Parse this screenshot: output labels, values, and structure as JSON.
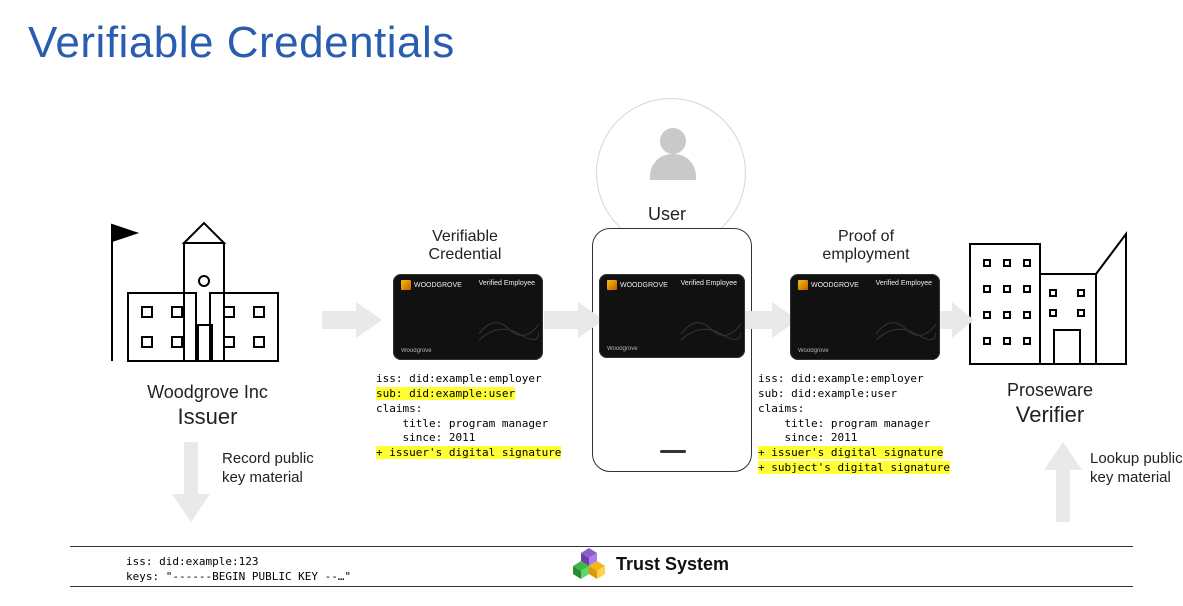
{
  "title": "Verifiable Credentials",
  "issuer": {
    "name": "Woodgrove Inc",
    "role": "Issuer"
  },
  "user": {
    "label": "User"
  },
  "verifier": {
    "name": "Proseware",
    "role": "Verifier"
  },
  "flows": {
    "vc_label": "Verifiable\nCredential",
    "proof_label": "Proof of\nemployment",
    "record_label": "Record public\nkey material",
    "lookup_label": "Lookup public\nkey material"
  },
  "card": {
    "brand": "WOODGROVE",
    "tag": "Verified Employee",
    "issuer_name": "Woodgrove"
  },
  "vc_claims": {
    "iss": "iss: did:example:employer",
    "sub": "sub: did:example:user",
    "claims_h": "claims:",
    "title": "    title: program manager",
    "since": "    since: 2011",
    "sig_issuer": "+ issuer's digital signature",
    "sig_subject": "+ subject's digital signature"
  },
  "trust": {
    "label": "Trust  System",
    "iss": "iss: did:example:123",
    "keys": "keys: \"------BEGIN PUBLIC KEY --…\""
  }
}
